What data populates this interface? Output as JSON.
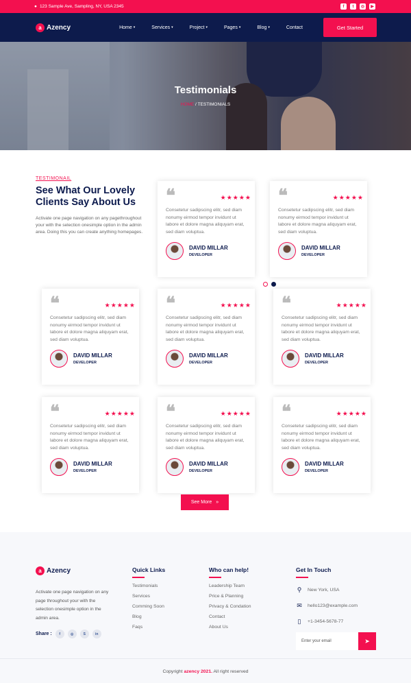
{
  "topbar": {
    "address": "123 Sample Ave, Sampling, NY, USA 2345",
    "social": [
      "facebook-icon",
      "twitter-icon",
      "instagram-icon",
      "youtube-icon"
    ]
  },
  "brand": {
    "logo_mark": "a",
    "name": "Azency"
  },
  "nav": {
    "items": [
      {
        "label": "Home",
        "dropdown": true
      },
      {
        "label": "Services",
        "dropdown": true
      },
      {
        "label": "Project",
        "dropdown": true
      },
      {
        "label": "Pages",
        "dropdown": true
      },
      {
        "label": "Blog",
        "dropdown": true
      },
      {
        "label": "Contact",
        "dropdown": false
      }
    ],
    "cta": "Get Started"
  },
  "hero": {
    "title": "Testimonials",
    "breadcrumb_home": "HOME",
    "breadcrumb_sep": " / ",
    "breadcrumb_current": "TESTIMONIALS"
  },
  "intro": {
    "tag": "TESTIMONAIL",
    "heading": "See What Our Lovely Clients Say About Us",
    "text": "Activate one page navigation on any pagethroughout your with the selection onesimple option in the admin area. Doing this you can create anything homepages."
  },
  "testimonials": [
    {
      "quote": "Consetetur sadipscing elitr, sed diam nonumy eirmod tempor invidunt ut labore et dolore magna aliquyam erat, sed diam voluptua.",
      "name": "DAVID MILLAR",
      "role": "DEVELOPER",
      "stars": "★★★★★"
    },
    {
      "quote": "Consetetur sadipscing elitr, sed diam nonumy eirmod tempor invidunt ut labore et dolore magna aliquyam erat, sed diam voluptua.",
      "name": "DAVID MILLAR",
      "role": "DEVELOPER",
      "stars": "★★★★★"
    },
    {
      "quote": "Consetetur sadipscing elitr, sed diam nonumy eirmod tempor invidunt ut labore et dolore magna aliquyam erat, sed diam voluptua.",
      "name": "DAVID MILLAR",
      "role": "DEVELOPER",
      "stars": "★★★★★"
    },
    {
      "quote": "Consetetur sadipscing elitr, sed diam nonumy eirmod tempor invidunt ut labore et dolore magna aliquyam erat, sed diam voluptua.",
      "name": "DAVID MILLAR",
      "role": "DEVELOPER",
      "stars": "★★★★★"
    },
    {
      "quote": "Consetetur sadipscing elitr, sed diam nonumy eirmod tempor invidunt ut labore et dolore magna aliquyam erat, sed diam voluptua.",
      "name": "DAVID MILLAR",
      "role": "DEVELOPER",
      "stars": "★★★★★"
    },
    {
      "quote": "Consetetur sadipscing elitr, sed diam nonumy eirmod tempor invidunt ut labore et dolore magna aliquyam erat, sed diam voluptua.",
      "name": "DAVID MILLAR",
      "role": "DEVELOPER",
      "stars": "★★★★★"
    },
    {
      "quote": "Consetetur sadipscing elitr, sed diam nonumy eirmod tempor invidunt ut labore et dolore magna aliquyam erat, sed diam voluptua.",
      "name": "DAVID MILLAR",
      "role": "DEVELOPER",
      "stars": "★★★★★"
    },
    {
      "quote": "Consetetur sadipscing elitr, sed diam nonumy eirmod tempor invidunt ut labore et dolore magna aliquyam erat, sed diam voluptua.",
      "name": "DAVID MILLAR",
      "role": "DEVELOPER",
      "stars": "★★★★★"
    }
  ],
  "see_more": "See More",
  "footer": {
    "about": "Activate one page navigation on any page throughout your with the selection onesimple option in the admin area.",
    "share_label": "Share :",
    "share_icons": [
      "f",
      "◎",
      "S",
      "in"
    ],
    "quick_links_title": "Quick Links",
    "quick_links": [
      "Testimonials",
      "Services",
      "Comming Soon",
      "Blog",
      "Faqs"
    ],
    "help_title": "Who can help!",
    "help_links": [
      "Leadership Team",
      "Price & Planning",
      "Privacy & Condation",
      "Contact",
      "About Us"
    ],
    "contact_title": "Get In Touch",
    "location": "New York, USA",
    "email": "hello123@example.com",
    "phone": "+1-3454-5678-77",
    "email_placeholder": "Enter your email",
    "copyright_pre": "Copyright ",
    "copyright_brand": "azency 2021.",
    "copyright_post": " All right reserved"
  },
  "colors": {
    "accent": "#f3104f",
    "navy": "#0d1b4c"
  }
}
